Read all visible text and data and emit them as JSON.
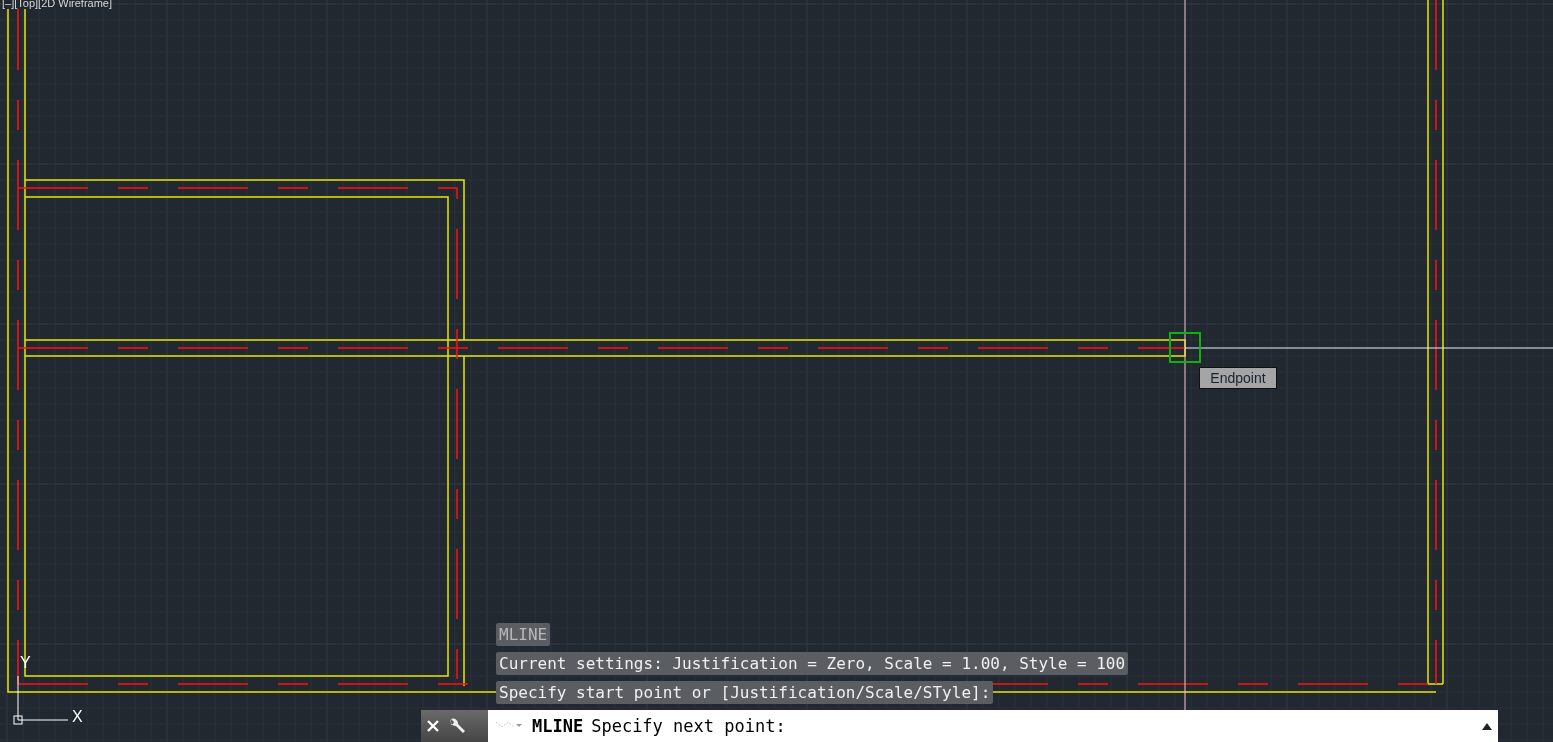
{
  "viewport_label": "[–][Top][2D Wireframe]",
  "tooltip": "Endpoint",
  "ucs": {
    "y_label": "Y",
    "x_label": "X"
  },
  "history": [
    {
      "text": "MLINE",
      "dim": true
    },
    {
      "text": "Current settings: Justification = Zero, Scale = 1.00, Style = 100",
      "dim": false
    },
    {
      "text": "Specify start point or [Justification/Scale/STyle]:",
      "dim": false
    }
  ],
  "command_line": {
    "command": "MLINE",
    "prompt": "Specify next point:"
  }
}
